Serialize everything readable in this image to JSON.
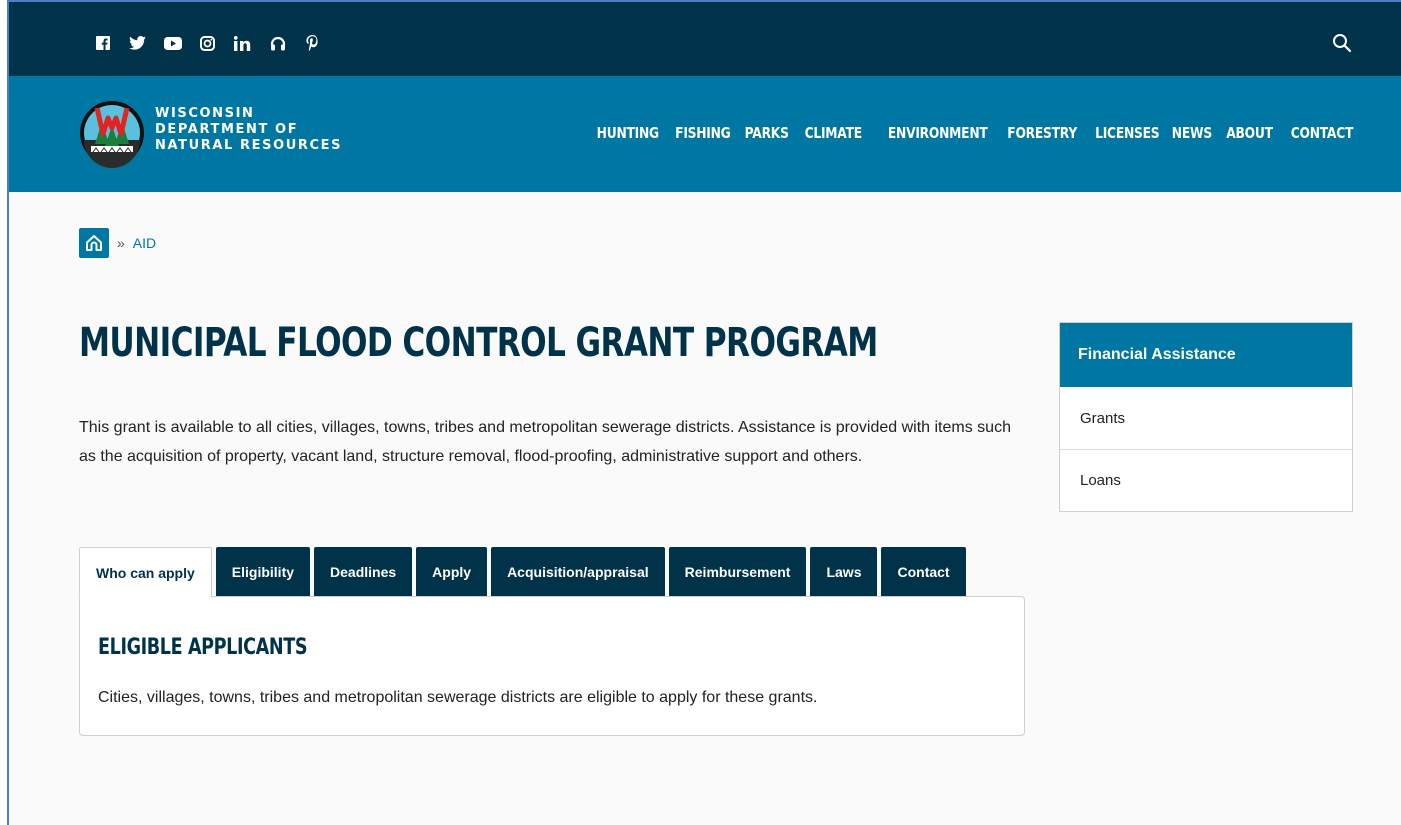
{
  "social": {
    "icons": [
      {
        "name": "facebook-icon",
        "glyph": "f"
      },
      {
        "name": "twitter-icon",
        "glyph": "t"
      },
      {
        "name": "youtube-icon",
        "glyph": "▶"
      },
      {
        "name": "instagram-icon",
        "glyph": "◎"
      },
      {
        "name": "linkedin-icon",
        "glyph": "in"
      },
      {
        "name": "podcast-icon",
        "glyph": "∩"
      },
      {
        "name": "pinterest-icon",
        "glyph": "p"
      }
    ]
  },
  "header": {
    "org_line1": "WISCONSIN",
    "org_line2": "DEPARTMENT OF",
    "org_line3": "NATURAL RESOURCES",
    "nav": [
      "HUNTING",
      "FISHING",
      "PARKS",
      "CLIMATE",
      "ENVIRONMENT",
      "FORESTRY",
      "LICENSES",
      "NEWS",
      "ABOUT",
      "CONTACT"
    ]
  },
  "breadcrumb": {
    "separator": "»",
    "current": "AID"
  },
  "main": {
    "title": "MUNICIPAL FLOOD CONTROL GRANT PROGRAM",
    "intro": "This grant is available to all cities, villages, towns, tribes and metropolitan sewerage districts. Assistance is provided with items such as the acquisition of property, vacant land, structure removal, flood-proofing, administrative support and others.",
    "tabs": [
      "Who can apply",
      "Eligibility",
      "Deadlines",
      "Apply",
      "Acquisition/appraisal",
      "Reimbursement",
      "Laws",
      "Contact"
    ],
    "active_tab": "Who can apply",
    "panel_heading": "ELIGIBLE APPLICANTS",
    "panel_text": "Cities, villages, towns, tribes and metropolitan sewerage districts are eligible to apply for these grants."
  },
  "sidebar": {
    "heading": "Financial Assistance",
    "items": [
      "Grants",
      "Loans"
    ]
  },
  "colors": {
    "topbar": "#003249",
    "navbar": "#0077a3",
    "title": "#003249",
    "link": "#0077a3"
  }
}
